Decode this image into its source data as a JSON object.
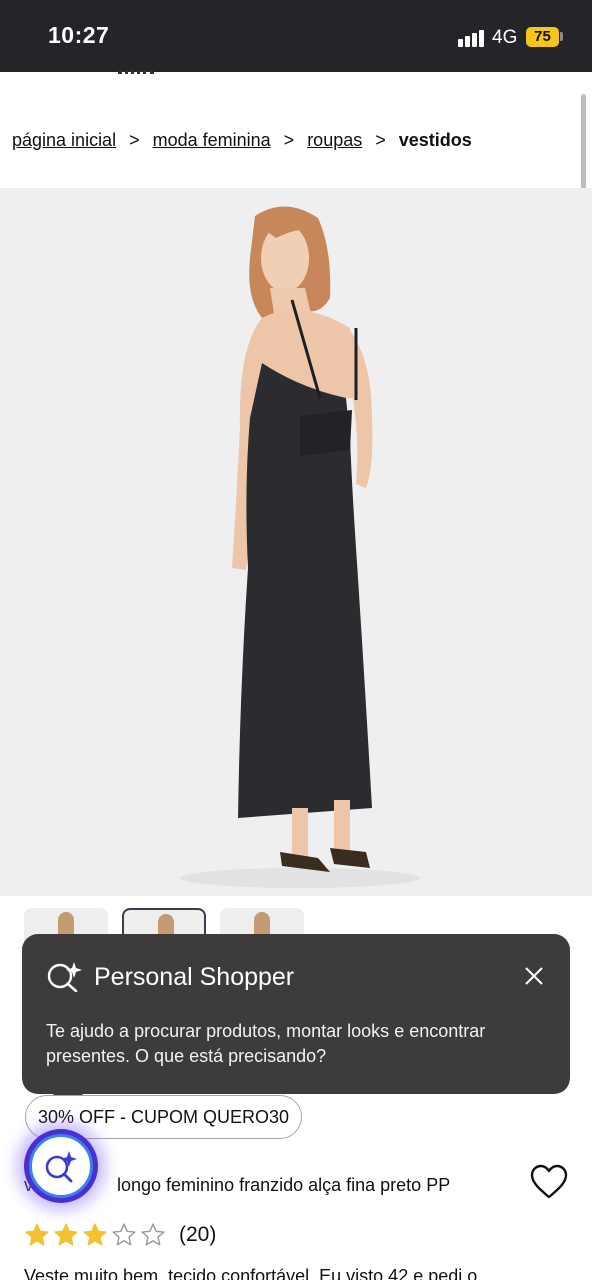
{
  "status_bar": {
    "time": "10:27",
    "network": "4G",
    "battery": "75"
  },
  "breadcrumb": [
    {
      "label": "página inicial"
    },
    {
      "label": "moda feminina"
    },
    {
      "label": "roupas"
    },
    {
      "label": "vestidos"
    }
  ],
  "breadcrumb_separator": ">",
  "personal_shopper": {
    "title": "Personal Shopper",
    "message": "Te ajudo a procurar produtos, montar looks e encontrar presentes. O que está precisando?"
  },
  "coupon_label": "30% OFF - CUPOM QUERO30",
  "product": {
    "title_visible_part": "longo feminino franzido alça fina preto PP",
    "title_prefix_visible": "v",
    "rating": 3,
    "rating_max": 5,
    "rating_count": "(20)",
    "review_snippet": "Veste muito bem, tecido confortável. Eu visto 42 e pedi o"
  },
  "icons": {
    "popup": "sparkle-search-icon",
    "close": "close-icon",
    "fab": "sparkle-search-icon",
    "favorite": "heart-icon",
    "star": "star-icon"
  },
  "colors": {
    "status_bar": "#232529",
    "popup_bg": "#3d3b3b",
    "battery": "#f5c518",
    "star_filled": "#f2c230",
    "fab_accent": "#4b2fd6"
  }
}
